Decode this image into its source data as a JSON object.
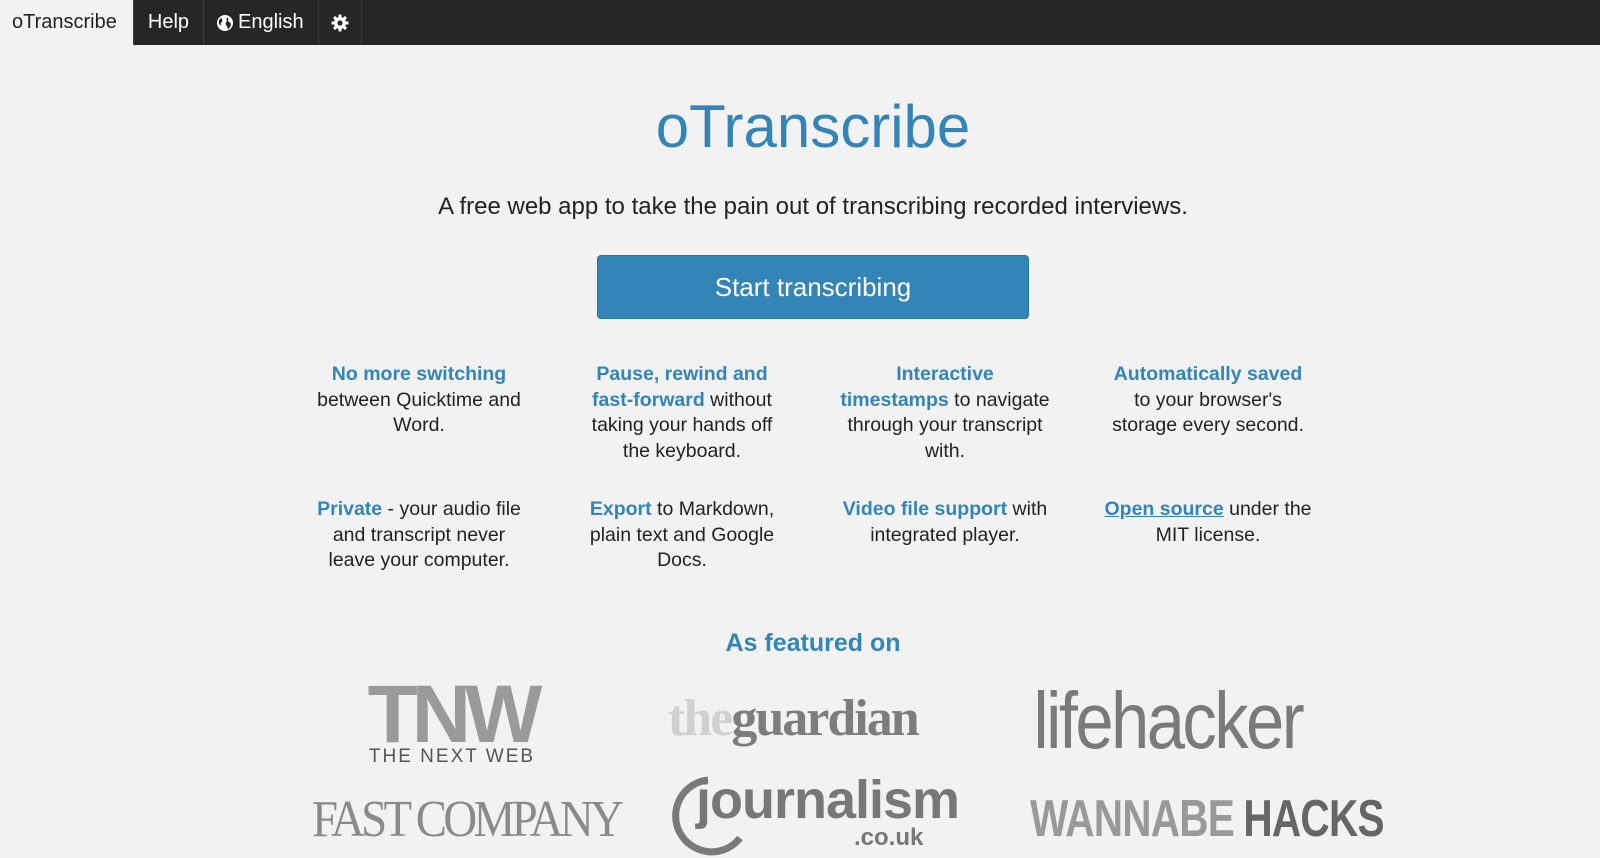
{
  "nav": {
    "home": "oTranscribe",
    "help": "Help",
    "language": "English",
    "settings_icon": "gear-icon",
    "language_icon": "globe-icon"
  },
  "hero": {
    "title": "oTranscribe",
    "subtitle": "A free web app to take the pain out of transcribing recorded interviews.",
    "cta": "Start transcribing"
  },
  "features": [
    {
      "highlight": "No more switching",
      "rest": " between Quicktime and Word."
    },
    {
      "highlight": "Pause, rewind and fast-forward",
      "rest": " without taking your hands off the keyboard."
    },
    {
      "highlight": "Interactive timestamps",
      "rest": " to navigate through your transcript with."
    },
    {
      "highlight": "Automatically saved",
      "rest": " to your browser's storage every second."
    },
    {
      "highlight": "Private",
      "rest": " - your audio file and transcript never leave your computer."
    },
    {
      "highlight": "Export",
      "rest": " to Markdown, plain text and Google Docs."
    },
    {
      "highlight": "Video file support",
      "rest": " with integrated player."
    },
    {
      "highlight": "Open source",
      "rest": " under the MIT license."
    }
  ],
  "featured": {
    "heading": "As featured on",
    "logos": {
      "tnw_main": "TNW",
      "tnw_sub": "THE NEXT WEB",
      "guardian_the": "the",
      "guardian_main": "guardian",
      "lifehacker": "lifehacker",
      "fastcompany": "FAST COMPANY",
      "journalism_main": "journalism",
      "journalism_sub": ".co.uk",
      "wannabe": "WANNABE",
      "hacks": "HACKS"
    }
  },
  "colors": {
    "accent": "#3385b8",
    "topbar": "#262626",
    "background": "#f2f2f2"
  }
}
